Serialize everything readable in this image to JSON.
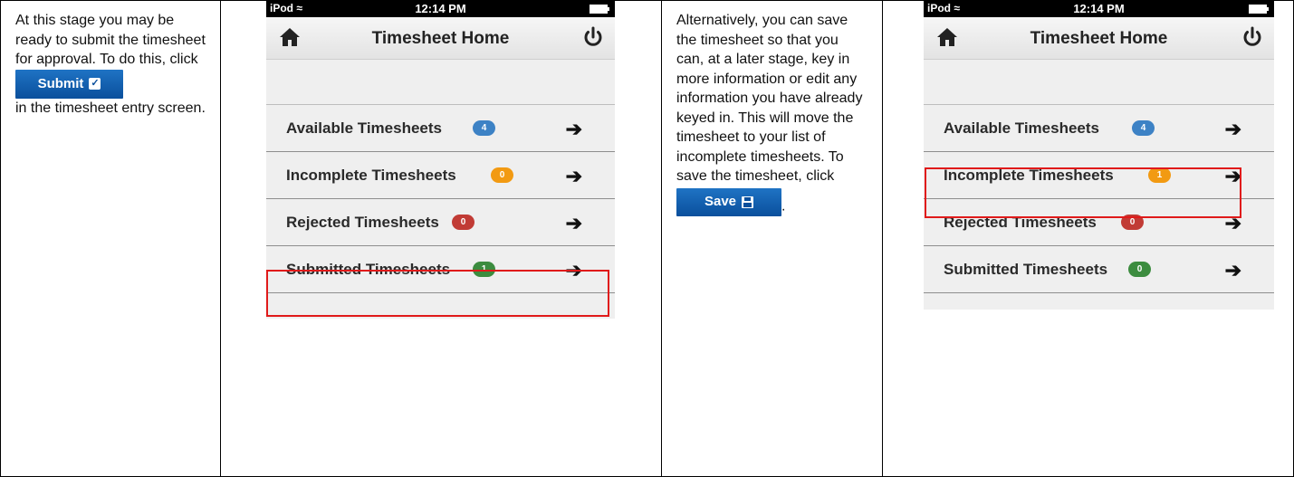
{
  "cells": {
    "intro_text_before": "At this stage you may be ready to submit the timesheet for approval. To do this, click",
    "intro_text_after": "in the timesheet entry screen.",
    "submit_button": "Submit",
    "alt_text": "Alternatively, you can save the timesheet so that you can, at a later stage, key in more information or edit any information you have already keyed in. This will move the timesheet to your list of incomplete timesheets. To save the timesheet, click",
    "alt_text_end": ".",
    "save_button": "Save"
  },
  "phone1": {
    "carrier": "iPod",
    "time": "12:14 PM",
    "title": "Timesheet Home",
    "rows": [
      {
        "label": "Available Timesheets",
        "count": "4",
        "color": "#3d82c5"
      },
      {
        "label": "Incomplete Timesheets",
        "count": "0",
        "color": "#f29a12"
      },
      {
        "label": "Rejected Timesheets",
        "count": "0",
        "color": "#c13b35"
      },
      {
        "label": "Submitted Timesheets",
        "count": "1",
        "color": "#3c8c3f"
      }
    ],
    "highlighted_row": "Submitted Timesheets"
  },
  "phone2": {
    "carrier": "iPod",
    "time": "12:14 PM",
    "title": "Timesheet Home",
    "rows": [
      {
        "label": "Available Timesheets",
        "count": "4",
        "color": "#3d82c5"
      },
      {
        "label": "Incomplete Timesheets",
        "count": "1",
        "color": "#f29a12"
      },
      {
        "label": "Rejected Timesheets",
        "count": "0",
        "color": "#c13b35"
      },
      {
        "label": "Submitted Timesheets",
        "count": "0",
        "color": "#3c8c3f"
      }
    ],
    "highlighted_row": "Incomplete Timesheets"
  },
  "colors": {
    "highlight": "#e01a1a",
    "button": "#0a4f9c"
  }
}
